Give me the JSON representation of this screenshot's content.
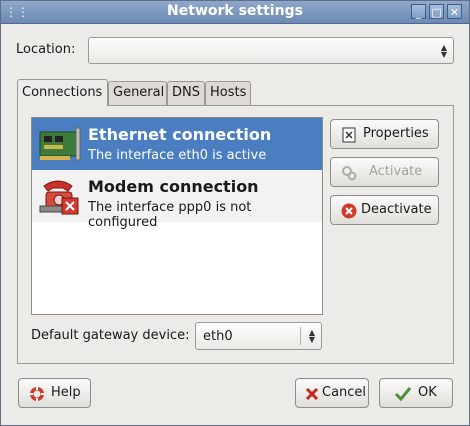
{
  "window": {
    "title": "Network settings"
  },
  "location": {
    "label": "Location:",
    "value": ""
  },
  "tabs": [
    {
      "label": "Connections"
    },
    {
      "label": "General"
    },
    {
      "label": "DNS"
    },
    {
      "label": "Hosts"
    }
  ],
  "connections": [
    {
      "name": "Ethernet connection",
      "description": "The interface eth0 is active",
      "icon": "network-card-icon",
      "selected": true
    },
    {
      "name": "Modem connection",
      "description": "The interface ppp0 is not configured",
      "icon": "modem-phone-icon",
      "selected": false
    }
  ],
  "actions": {
    "properties": "Properties",
    "activate": "Activate",
    "deactivate": "Deactivate"
  },
  "gateway": {
    "label": "Default gateway device:",
    "value": "eth0"
  },
  "footer": {
    "help": "Help",
    "cancel": "Cancel",
    "ok": "OK"
  },
  "colors": {
    "selection": "#4a7ec0",
    "titlebar": "#7f9bc4",
    "window_bg": "#edebe8"
  }
}
